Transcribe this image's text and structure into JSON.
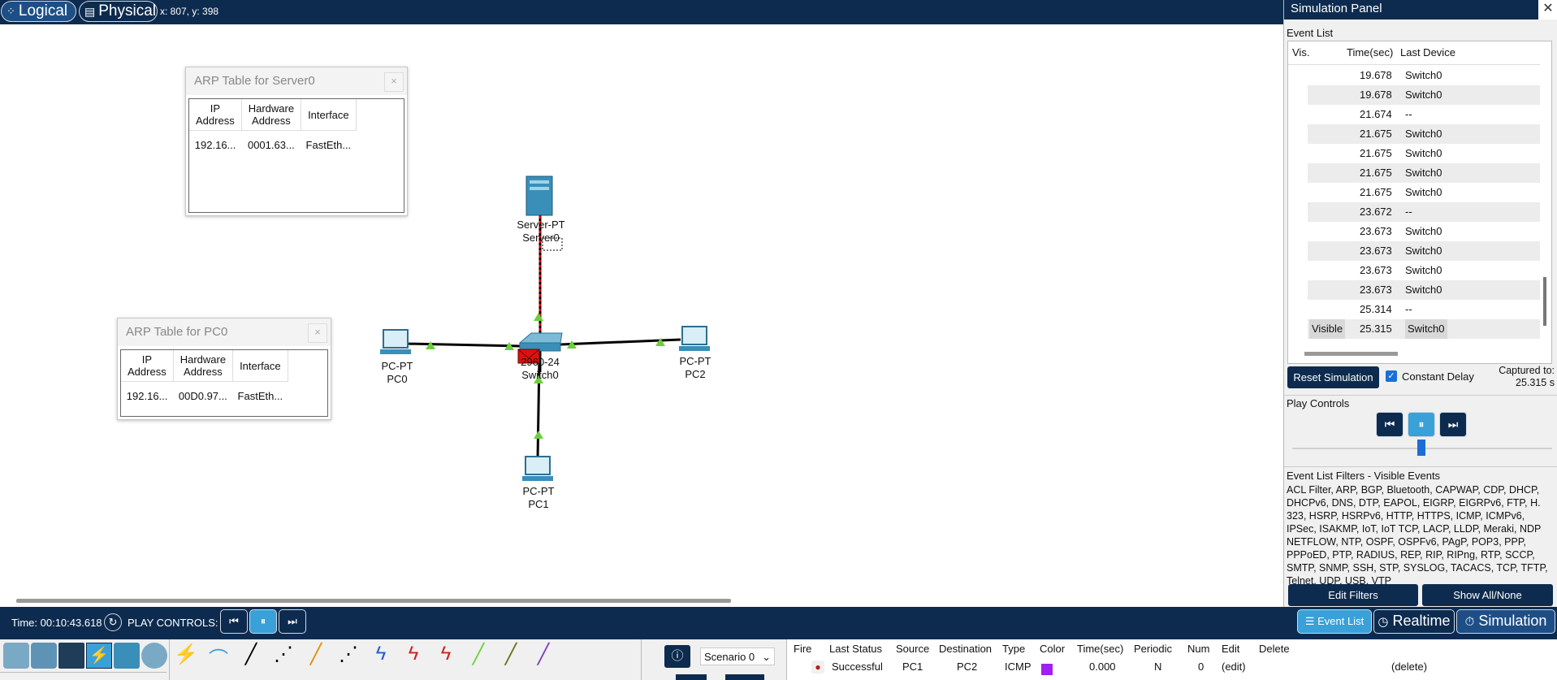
{
  "topbar": {
    "logical_label": "Logical",
    "physical_label": "Physical",
    "coords": "x: 807, y: 398"
  },
  "arp_server": {
    "title": "ARP Table for Server0",
    "close": "×",
    "headers": [
      "IP\nAddress",
      "Hardware\nAddress",
      "Interface"
    ],
    "row": [
      "192.16...",
      "0001.63...",
      "FastEth..."
    ]
  },
  "arp_pc0": {
    "title": "ARP Table for PC0",
    "close": "×",
    "headers": [
      "IP\nAddress",
      "Hardware\nAddress",
      "Interface"
    ],
    "row": [
      "192.16...",
      "00D0.97...",
      "FastEth..."
    ]
  },
  "devices": {
    "server": {
      "model": "Server-PT",
      "name": "Server0"
    },
    "switch": {
      "model": "2960-24",
      "name": "Switch0"
    },
    "pc0": {
      "model": "PC-PT",
      "name": "PC0"
    },
    "pc1": {
      "model": "PC-PT",
      "name": "PC1"
    },
    "pc2": {
      "model": "PC-PT",
      "name": "PC2"
    }
  },
  "sim": {
    "title": "Simulation Panel",
    "close": "✕",
    "event_list_label": "Event List",
    "col_vis": "Vis.",
    "col_time": "Time(sec)",
    "col_last": "Last Device",
    "events": [
      {
        "vis": "",
        "time": "19.678",
        "device": "Switch0"
      },
      {
        "vis": "",
        "time": "19.678",
        "device": "Switch0"
      },
      {
        "vis": "",
        "time": "21.674",
        "device": "--"
      },
      {
        "vis": "",
        "time": "21.675",
        "device": "Switch0"
      },
      {
        "vis": "",
        "time": "21.675",
        "device": "Switch0"
      },
      {
        "vis": "",
        "time": "21.675",
        "device": "Switch0"
      },
      {
        "vis": "",
        "time": "21.675",
        "device": "Switch0"
      },
      {
        "vis": "",
        "time": "23.672",
        "device": "--"
      },
      {
        "vis": "",
        "time": "23.673",
        "device": "Switch0"
      },
      {
        "vis": "",
        "time": "23.673",
        "device": "Switch0"
      },
      {
        "vis": "",
        "time": "23.673",
        "device": "Switch0"
      },
      {
        "vis": "",
        "time": "23.673",
        "device": "Switch0"
      },
      {
        "vis": "",
        "time": "25.314",
        "device": "--"
      },
      {
        "vis": "Visible",
        "time": "25.315",
        "device": "Switch0"
      }
    ],
    "reset_label": "Reset Simulation",
    "constant_delay_label": "Constant Delay",
    "constant_delay_checked": true,
    "captured_label": "Captured to:",
    "captured_value": "25.315 s",
    "play_controls_label": "Play Controls",
    "filters_label": "Event List Filters - Visible Events",
    "filters_text": "ACL Filter, ARP, BGP, Bluetooth, CAPWAP, CDP, DHCP, DHCPv6, DNS, DTP, EAPOL, EIGRP, EIGRPv6, FTP, H. 323, HSRP, HSRPv6, HTTP, HTTPS, ICMP, ICMPv6, IPSec, ISAKMP, IoT, IoT TCP, LACP, LLDP, Meraki, NDP NETFLOW, NTP, OSPF, OSPFv6, PAgP, POP3, PPP, PPPoED, PTP, RADIUS, REP, RIP, RIPng, RTP, SCCP, SMTP, SNMP, SSH, STP, SYSLOG, TACACS, TCP, TFTP, Telnet, UDP, USB, VTP",
    "edit_filters_label": "Edit Filters",
    "show_all_label": "Show All/None"
  },
  "bottom": {
    "time": "Time: 00:10:43.618",
    "play_controls": "PLAY CONTROLS:",
    "event_list_btn": "Event List",
    "realtime_btn": "Realtime",
    "simulation_btn": "Simulation"
  },
  "pdu": {
    "scenario": "Scenario 0",
    "headers": [
      "Fire",
      "Last Status",
      "Source",
      "Destination",
      "Type",
      "Color",
      "Time(sec)",
      "Periodic",
      "Num",
      "Edit",
      "Delete"
    ],
    "row": {
      "status": "Successful",
      "source": "PC1",
      "destination": "PC2",
      "type": "ICMP",
      "color": "#a020f0",
      "time": "0.000",
      "periodic": "N",
      "num": "0",
      "edit": "(edit)",
      "delete": "(delete)"
    }
  },
  "colors": {
    "navy": "#0d2b4e",
    "link": "#000000",
    "packet_path": "#e00000",
    "arrow": "#6ccf3a",
    "pdu_color": "#a020f0"
  }
}
